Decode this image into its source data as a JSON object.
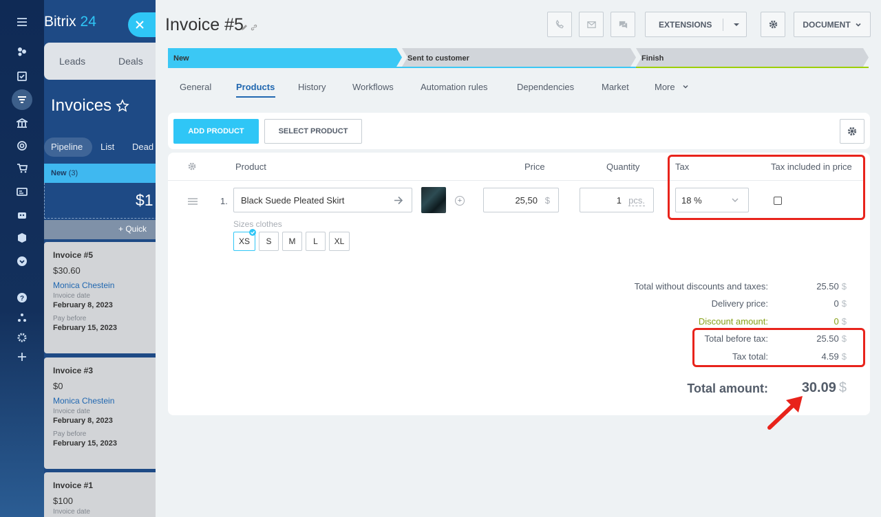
{
  "app": {
    "logo_main": "Bitrix",
    "logo_num": "24"
  },
  "bg_page": {
    "nav": [
      "Leads",
      "Deals"
    ],
    "title": "Invoices",
    "stage_tabs": [
      "Pipeline",
      "List",
      "Dead"
    ],
    "column": {
      "name": "New",
      "count": "(3)",
      "sum": "$1",
      "quick": "Quick"
    },
    "cards": [
      {
        "title": "Invoice #5",
        "amount": "$30.60",
        "client": "Monica Chestein",
        "date_label": "Invoice date",
        "date": "February 8, 2023",
        "pay_label": "Pay before",
        "pay": "February 15, 2023"
      },
      {
        "title": "Invoice #3",
        "amount": "$0",
        "client": "Monica Chestein",
        "date_label": "Invoice date",
        "date": "February 8, 2023",
        "pay_label": "Pay before",
        "pay": "February 15, 2023"
      },
      {
        "title": "Invoice #1",
        "amount": "$100",
        "date_label": "Invoice date"
      }
    ]
  },
  "header": {
    "title": "Invoice #5",
    "extensions_label": "EXTENSIONS",
    "document_label": "DOCUMENT"
  },
  "stages": [
    {
      "label": "New",
      "color": "#3bc8f5"
    },
    {
      "label": "Sent to customer",
      "color": "#d1d5da"
    },
    {
      "label": "Finish",
      "color": "#d1d5da"
    }
  ],
  "tabs": [
    "General",
    "Products",
    "History",
    "Workflows",
    "Automation rules",
    "Dependencies",
    "Market",
    "More"
  ],
  "toolbar": {
    "add_label": "ADD PRODUCT",
    "select_label": "SELECT PRODUCT"
  },
  "table": {
    "headers": {
      "product": "Product",
      "price": "Price",
      "quantity": "Quantity",
      "tax": "Tax",
      "tax_included": "Tax included in price"
    },
    "row": {
      "index": "1.",
      "name": "Black Suede Pleated Skirt",
      "price": "25,50",
      "price_currency": "$",
      "quantity": "1",
      "unit": "pcs.",
      "tax": "18 %",
      "sizes_label": "Sizes clothes",
      "sizes": [
        "XS",
        "S",
        "M",
        "L",
        "XL"
      ]
    }
  },
  "totals": {
    "without_label": "Total without discounts and taxes:",
    "without_value": "25.50",
    "delivery_label": "Delivery price:",
    "delivery_value": "0",
    "discount_label": "Discount amount:",
    "discount_value": "0",
    "before_tax_label": "Total before tax:",
    "before_tax_value": "25.50",
    "tax_label": "Tax total:",
    "tax_value": "4.59",
    "amount_label": "Total amount:",
    "amount_value": "30.09",
    "currency": "$"
  },
  "colors": {
    "accent": "#2fc6f6",
    "active_tab": "#2067b0",
    "annotation": "#e8231b",
    "discount": "#86a117"
  }
}
